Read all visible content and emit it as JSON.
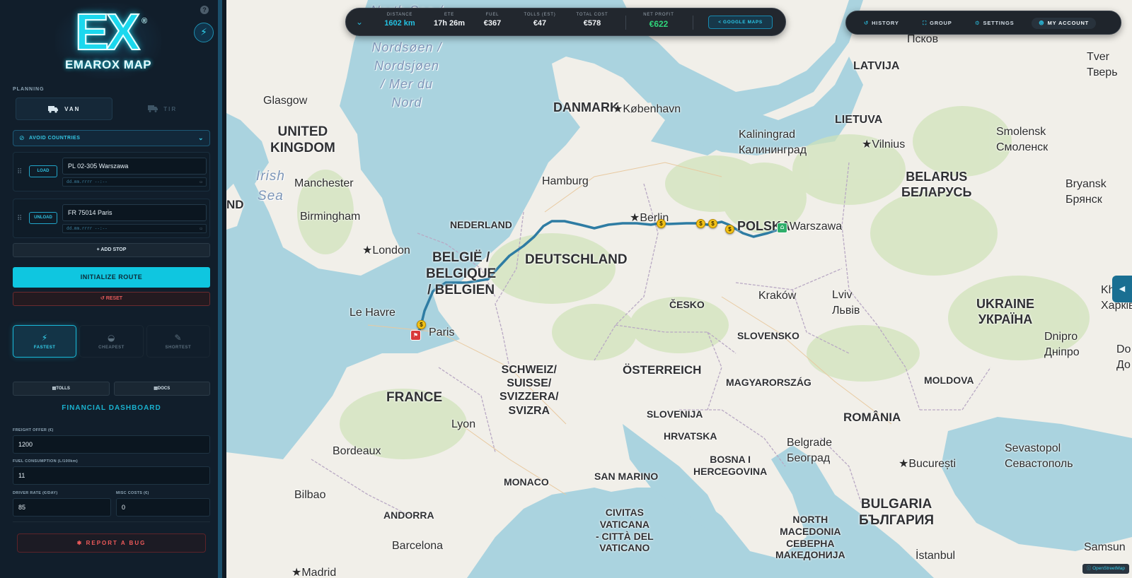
{
  "sidebar": {
    "logo": {
      "letters": "EX",
      "registered": "®",
      "name": "EMAROX MAP"
    },
    "help_label": "?",
    "planning_label": "PLANNING",
    "vehicle_modes": [
      {
        "label": "VAN",
        "icon": "van-icon",
        "active": true
      },
      {
        "label": "TIR",
        "icon": "truck-icon",
        "active": false
      }
    ],
    "avoid_countries_label": "AVOID COUNTRIES",
    "stops": [
      {
        "tag": "LOAD",
        "address": "PL 02-305 Warszawa",
        "datetime_placeholder": "dd.mm.rrrr --:--"
      },
      {
        "tag": "UNLOAD",
        "address": "FR 75014 Paris",
        "datetime_placeholder": "dd.mm.rrrr --:--"
      }
    ],
    "add_stop_label": "+ ADD STOP",
    "initialize_label": "INITIALIZE ROUTE",
    "reset_label": "RESET",
    "route_options": [
      {
        "label": "FASTEST",
        "icon": "lightning-icon",
        "active": true
      },
      {
        "label": "CHEAPEST",
        "icon": "piggy-bank-icon",
        "active": false
      },
      {
        "label": "SHORTEST",
        "icon": "ruler-icon",
        "active": false
      }
    ],
    "tolls_label": "TOLLS",
    "docs_label": "DOCS",
    "financial_title": "FINANCIAL DASHBOARD",
    "fields": {
      "freight_offer": {
        "label": "FREIGHT OFFER (€)",
        "value": "1200"
      },
      "fuel_consumption": {
        "label": "FUEL CONSUMPTION (L/100km)",
        "value": "11"
      },
      "driver_rate": {
        "label": "DRIVER RATE (€/DAY)",
        "value": "85"
      },
      "misc_costs": {
        "label": "MISC COSTS (€)",
        "value": "0"
      }
    },
    "report_bug_label": "REPORT A BUG"
  },
  "stats": {
    "distance": {
      "label": "DISTANCE",
      "value": "1602 km"
    },
    "ete": {
      "label": "ETE",
      "value": "17h 26m"
    },
    "fuel": {
      "label": "FUEL",
      "value": "€367"
    },
    "tolls": {
      "label": "TOLLS (EST)",
      "value": "€47"
    },
    "total_cost": {
      "label": "TOTAL COST",
      "value": "€578"
    },
    "net_profit": {
      "label": "NET PROFIT",
      "value": "€622"
    },
    "google_maps_label": "GOOGLE MAPS"
  },
  "topnav": {
    "history": "HISTORY",
    "group": "GROUP",
    "settings": "SETTINGS",
    "account": "MY ACCOUNT"
  },
  "map": {
    "attribution": "OpenStreetMap",
    "countries": {
      "uk": "UNITED\nKINGDOM",
      "nl": "NEDERLAND",
      "be": "BELGIË /\nBELGIQUE\n/ BELGIEN",
      "de": "DEUTSCHLAND",
      "fr": "FRANCE",
      "ch": "SCHWEIZ/\nSUISSE/\nSVIZZERA/\nSVIZRA",
      "at": "ÖSTERREICH",
      "cz": "ČESKO",
      "sk": "SLOVENSKO",
      "hu": "MAGYARORSZÁG",
      "si": "SLOVENIJA",
      "hr": "HRVATSKA",
      "ba": "BOSNA I\nHERCEGOVINA",
      "rs": "",
      "mk": "NORTH\nMACEDONIA\nСЕВЕРНА\nМАКЕДОНИЈА",
      "ro": "ROMÂNIA",
      "md": "MOLDOVA",
      "ua": "UKRAINE\nУКРАЇНА",
      "by": "BELARUS\nБЕЛАРУСЬ",
      "lt": "LIETUVA",
      "lv": "LATVIJA",
      "dk": "DANMARK",
      "pl": "POLSKA",
      "bg": "BULGARIA\nБЪЛГАРИЯ",
      "sm": "SAN MARINO",
      "mc": "MONACO",
      "ad": "ANDORRA",
      "va": "CIVITAS\nVATICANA\n- CITTÀ DEL\nVATICANO",
      "ie_edge": "ND"
    },
    "seas": {
      "north_sea": "North Sea /\nNoordzee /\nNordsøen /\nNordsjøen\n/ Mer du\nNord",
      "irish_sea": "Irish\nSea"
    },
    "cities": {
      "glasgow": "Glasgow",
      "manchester": "Manchester",
      "birmingham": "Birmingham",
      "london": "London",
      "le_havre": "Le Havre",
      "paris": "Paris",
      "bordeaux": "Bordeaux",
      "bilbao": "Bilbao",
      "barcelona": "Barcelona",
      "madrid": "Madrid",
      "lyon": "Lyon",
      "hamburg": "Hamburg",
      "berlin": "Berlin",
      "kobenhavn": "København",
      "warszawa": "Warszawa",
      "krakow": "Kraków",
      "lviv": "Lviv\nЛьвів",
      "kaliningrad": "Kaliningrad\nКалининград",
      "vilnius": "Vilnius",
      "pskov": "Псков",
      "tver": "Tver\nТверь",
      "smolensk": "Smolensk\nСмоленск",
      "bryansk": "Bryansk\nБрянск",
      "kharkiv": "Khar\nХарків",
      "dnipro": "Dnipro\nДнiпро",
      "do": "Do\nДо",
      "belgrade": "Belgrade\nБеоград",
      "bucuresti": "București",
      "sevastopol": "Sevastopol\nСевастополь",
      "samsun": "Samsun",
      "istanbul": "İstanbul"
    }
  }
}
